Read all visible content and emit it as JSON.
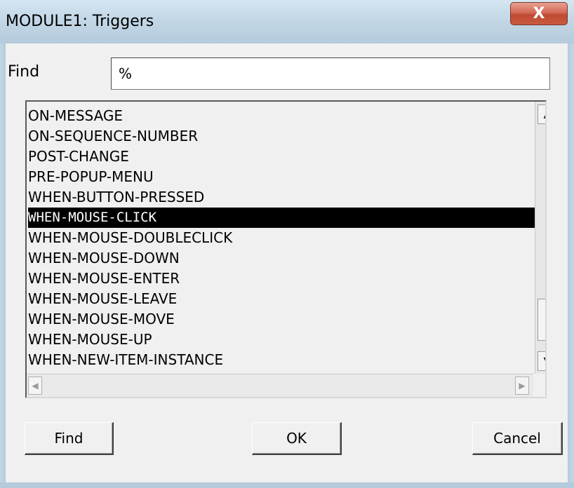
{
  "window": {
    "title": "MODULE1: Triggers",
    "close_label": "X"
  },
  "find": {
    "label": "Find",
    "value": "%"
  },
  "list": {
    "items": [
      "ON-MESSAGE",
      "ON-SEQUENCE-NUMBER",
      "POST-CHANGE",
      "PRE-POPUP-MENU",
      "WHEN-BUTTON-PRESSED",
      "WHEN-MOUSE-CLICK",
      "WHEN-MOUSE-DOUBLECLICK",
      "WHEN-MOUSE-DOWN",
      "WHEN-MOUSE-ENTER",
      "WHEN-MOUSE-LEAVE",
      "WHEN-MOUSE-MOVE",
      "WHEN-MOUSE-UP",
      "WHEN-NEW-ITEM-INSTANCE"
    ],
    "selected": "WHEN-MOUSE-CLICK"
  },
  "buttons": {
    "find": "Find",
    "ok": "OK",
    "cancel": "Cancel"
  },
  "icons": {
    "close": "close-icon",
    "scroll_up": "scroll-up-arrow-icon",
    "scroll_down": "scroll-down-arrow-icon",
    "scroll_left": "scroll-left-arrow-icon",
    "scroll_right": "scroll-right-arrow-icon"
  }
}
